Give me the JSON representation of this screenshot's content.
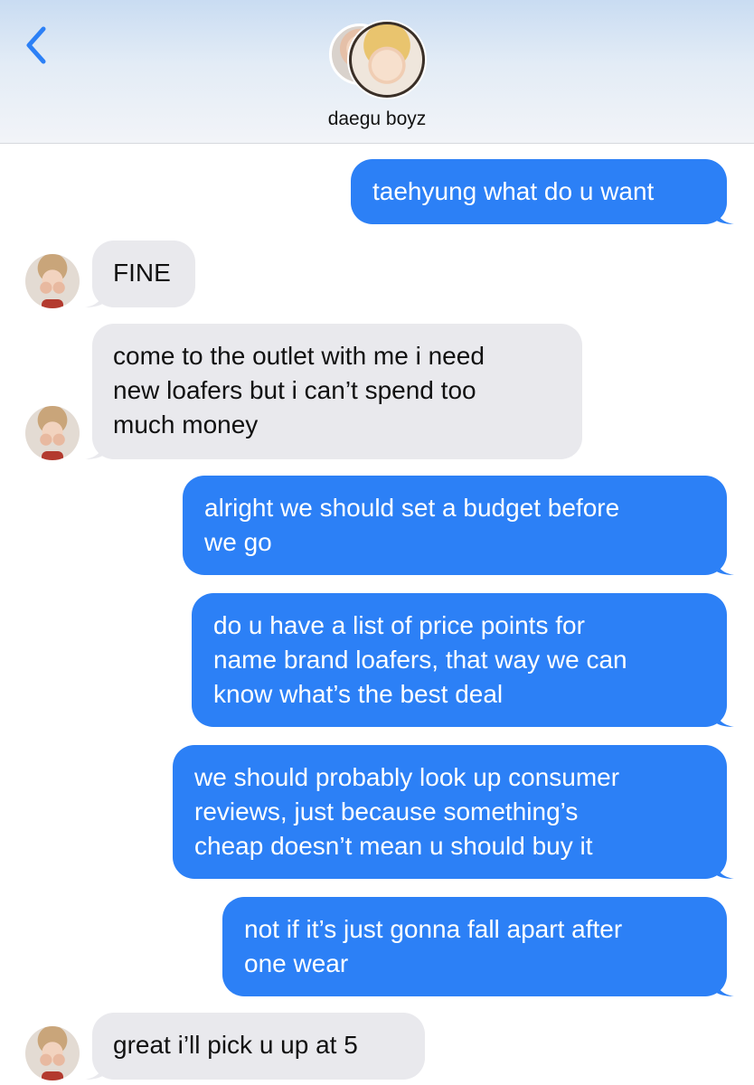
{
  "header": {
    "chat_title": "daegu boyz",
    "back_icon": "chevron-left-icon"
  },
  "colors": {
    "outgoing_bubble": "#2c80f6",
    "incoming_bubble": "#e9e9ed",
    "back_chevron": "#2c80f6"
  },
  "messages": [
    {
      "direction": "outgoing",
      "lines": [
        "taehyung what do u want"
      ]
    },
    {
      "direction": "incoming",
      "lines": [
        "FINE"
      ]
    },
    {
      "direction": "incoming",
      "lines": [
        "come to the outlet with me i need",
        "new loafers but i can’t spend too",
        "much money"
      ]
    },
    {
      "direction": "outgoing",
      "lines": [
        "alright we should set a budget before",
        "we go"
      ]
    },
    {
      "direction": "outgoing",
      "lines": [
        "do u have a list of price points for",
        "name brand loafers, that way we can",
        "know what’s the best deal"
      ]
    },
    {
      "direction": "outgoing",
      "lines": [
        "we should probably look up consumer",
        "reviews, just because something’s",
        "cheap doesn’t mean u should buy it"
      ]
    },
    {
      "direction": "outgoing",
      "lines": [
        "not if it’s just gonna fall apart after",
        "one wear"
      ]
    },
    {
      "direction": "incoming",
      "lines": [
        "great i’ll pick u up at 5"
      ]
    }
  ]
}
